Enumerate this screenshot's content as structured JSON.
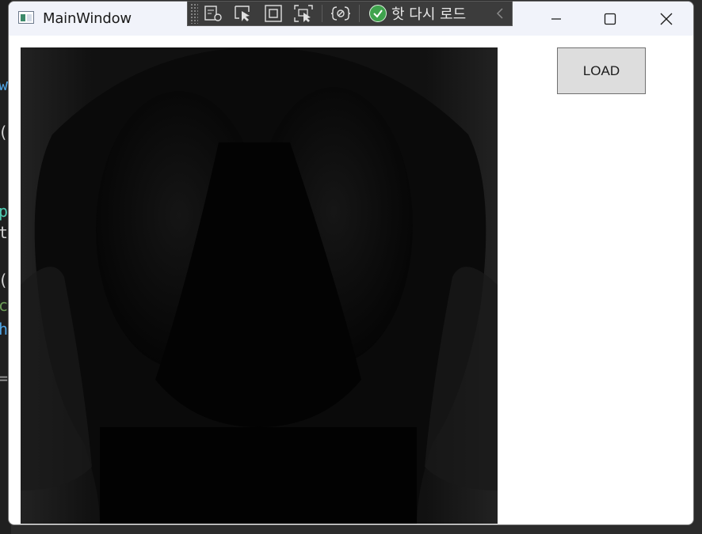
{
  "window": {
    "title": "MainWindow"
  },
  "debug_toolbar": {
    "hot_reload_label": "핫 다시 로드",
    "icons": [
      "live-visual-tree-icon",
      "select-element-icon",
      "display-layout-adorners-icon",
      "track-focused-element-icon",
      "binding-failures-icon"
    ]
  },
  "main": {
    "load_button_label": "LOAD",
    "image": "chest-xray-image"
  },
  "background_code": {
    "fragments": [
      "w",
      "(",
      "p",
      "t,",
      "(",
      "c",
      "h",
      "="
    ]
  },
  "colors": {
    "titlebar": "#f1f3fa",
    "debug_bar": "#3c3c3c",
    "hot_reload_check": "#3fa34d",
    "button_face": "#dddddd"
  }
}
